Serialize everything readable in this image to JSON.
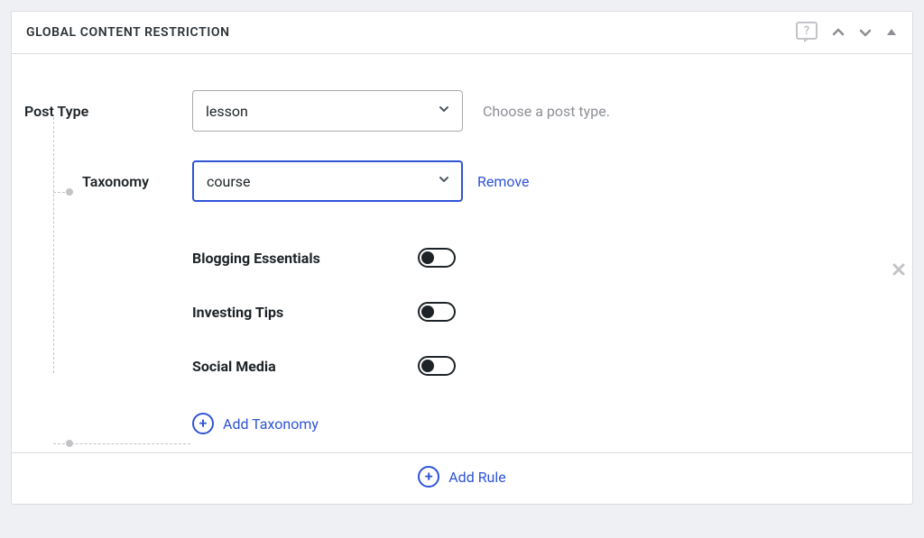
{
  "panel": {
    "title": "GLOBAL CONTENT RESTRICTION"
  },
  "postType": {
    "label": "Post Type",
    "value": "lesson",
    "hint": "Choose a post type."
  },
  "taxonomy": {
    "label": "Taxonomy",
    "value": "course",
    "removeLabel": "Remove",
    "items": [
      {
        "label": "Blogging Essentials",
        "on": false
      },
      {
        "label": "Investing Tips",
        "on": false
      },
      {
        "label": "Social Media",
        "on": false
      }
    ],
    "addLabel": "Add Taxonomy"
  },
  "footer": {
    "addRuleLabel": "Add Rule"
  }
}
